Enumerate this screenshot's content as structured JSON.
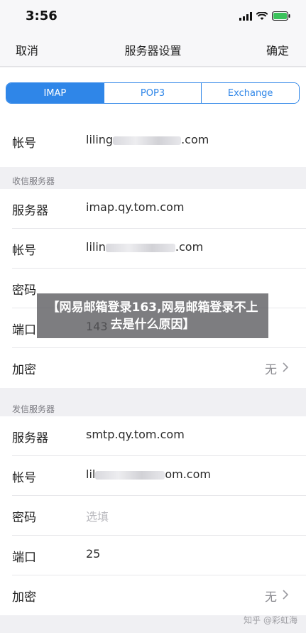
{
  "status": {
    "time": "3:56",
    "icons": [
      "signal-icon",
      "wifi-icon",
      "battery-icon"
    ]
  },
  "nav": {
    "cancel": "取消",
    "title": "服务器设置",
    "confirm": "确定"
  },
  "tabs": [
    {
      "label": "IMAP",
      "active": true
    },
    {
      "label": "POP3",
      "active": false
    },
    {
      "label": "Exchange",
      "active": false
    }
  ],
  "account": {
    "label": "帐号",
    "value_prefix": "liling",
    "value_suffix": ".com"
  },
  "incoming": {
    "section_title": "收信服务器",
    "server_label": "服务器",
    "server_value": "imap.qy.tom.com",
    "account_label": "帐号",
    "account_prefix": "lilin",
    "account_suffix": ".com",
    "password_label": "密码",
    "port_label": "端口",
    "port_value": "143",
    "encrypt_label": "加密",
    "encrypt_value": "无"
  },
  "outgoing": {
    "section_title": "发信服务器",
    "server_label": "服务器",
    "server_value": "smtp.qy.tom.com",
    "account_label": "帐号",
    "account_prefix": "lil",
    "account_suffix": "om.com",
    "password_label": "密码",
    "password_placeholder": "选填",
    "port_label": "端口",
    "port_value": "25",
    "encrypt_label": "加密",
    "encrypt_value": "无"
  },
  "overlay": {
    "text": "【网易邮箱登录163,网易邮箱登录不上去是什么原因】"
  },
  "watermark": {
    "text": "知乎 @彩虹海"
  },
  "colors": {
    "accent": "#2f86e8",
    "background": "#f0f0f3",
    "overlay": "#58585c"
  }
}
